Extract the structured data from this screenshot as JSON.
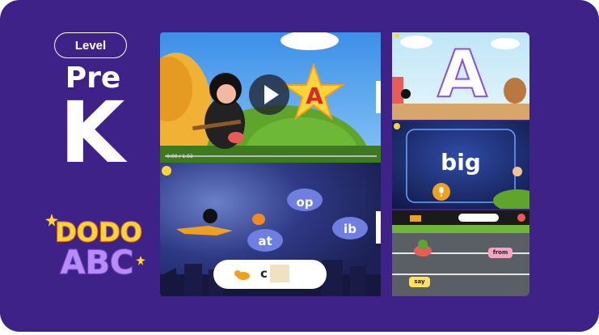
{
  "level": {
    "label": "Level",
    "grade_line1": "Pre",
    "grade_line2": "K"
  },
  "brand": {
    "logo_line1": "DODO",
    "logo_line2": "ABC"
  },
  "video": {
    "letter": "A",
    "time": "0:00 / 1:02"
  },
  "space_game": {
    "words": [
      "op",
      "at",
      "ib"
    ],
    "answer_prefix": "c"
  },
  "tracing": {
    "letter": "A"
  },
  "speaking": {
    "word": "big"
  },
  "racing": {
    "words": [
      "from",
      "say"
    ]
  },
  "colors": {
    "background": "#3e2287",
    "accent_yellow": "#ffd43b",
    "cloud": "#6f7fe0"
  }
}
